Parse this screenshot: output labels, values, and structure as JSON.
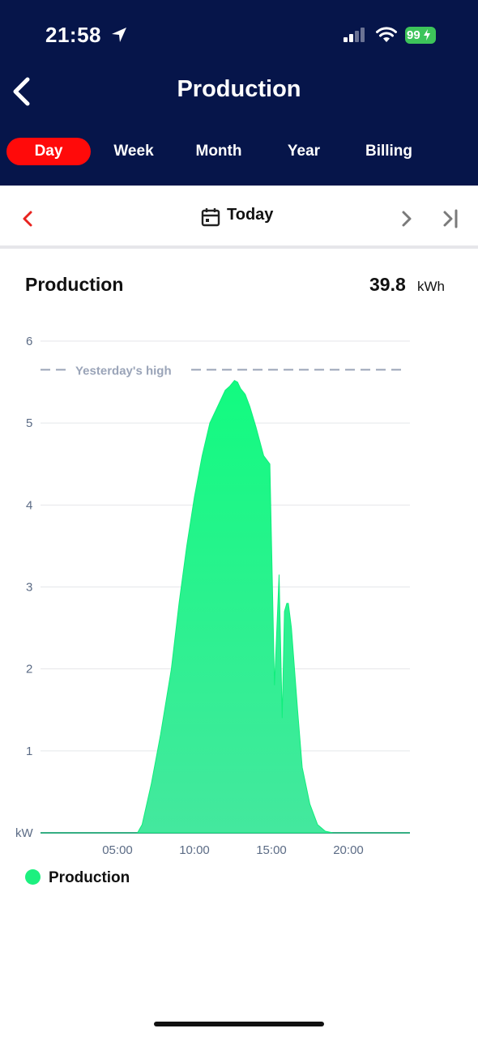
{
  "status_bar": {
    "time": "21:58",
    "battery": "99"
  },
  "header": {
    "title": "Production"
  },
  "tabs": [
    {
      "label": "Day",
      "active": true
    },
    {
      "label": "Week",
      "active": false
    },
    {
      "label": "Month",
      "active": false
    },
    {
      "label": "Year",
      "active": false
    },
    {
      "label": "Billing",
      "active": false
    }
  ],
  "date_nav": {
    "label": "Today"
  },
  "summary": {
    "label": "Production",
    "value": "39.8",
    "unit": "kWh"
  },
  "legend": {
    "label": "Production",
    "color": "#1cf07f"
  },
  "colors": {
    "header_bg": "#06154a",
    "active_tab": "#ff0a0a",
    "series": "#1cf07f",
    "reference_line": "#9aa4b8"
  },
  "chart_data": {
    "type": "area",
    "ylabel": "kW",
    "ylim": [
      0,
      6
    ],
    "yticks": [
      1,
      2,
      3,
      4,
      5,
      6
    ],
    "xlim": [
      0,
      24
    ],
    "xticks": [
      {
        "value": 5,
        "label": "05:00"
      },
      {
        "value": 10,
        "label": "10:00"
      },
      {
        "value": 15,
        "label": "15:00"
      },
      {
        "value": 20,
        "label": "20:00"
      }
    ],
    "grid": true,
    "reference_line": {
      "label": "Yesterday's high",
      "value": 5.65
    },
    "series": [
      {
        "name": "Production",
        "x": [
          0,
          6.3,
          6.6,
          7.2,
          7.8,
          8.5,
          9.0,
          9.5,
          10.0,
          10.5,
          11.0,
          11.5,
          12.0,
          12.3,
          12.6,
          12.8,
          13.0,
          13.3,
          13.6,
          14.0,
          14.5,
          14.9,
          15.2,
          15.5,
          15.7,
          15.85,
          16.0,
          16.1,
          16.3,
          16.5,
          16.7,
          17.0,
          17.5,
          18.0,
          18.5,
          19.0,
          19.5,
          24
        ],
        "y": [
          0,
          0,
          0.1,
          0.6,
          1.2,
          2.0,
          2.8,
          3.5,
          4.1,
          4.6,
          5.0,
          5.2,
          5.4,
          5.45,
          5.52,
          5.5,
          5.42,
          5.35,
          5.2,
          4.95,
          4.6,
          4.5,
          1.8,
          3.15,
          1.4,
          2.7,
          2.8,
          2.8,
          2.5,
          2.0,
          1.5,
          0.8,
          0.35,
          0.1,
          0.02,
          0,
          0,
          0
        ]
      }
    ]
  }
}
